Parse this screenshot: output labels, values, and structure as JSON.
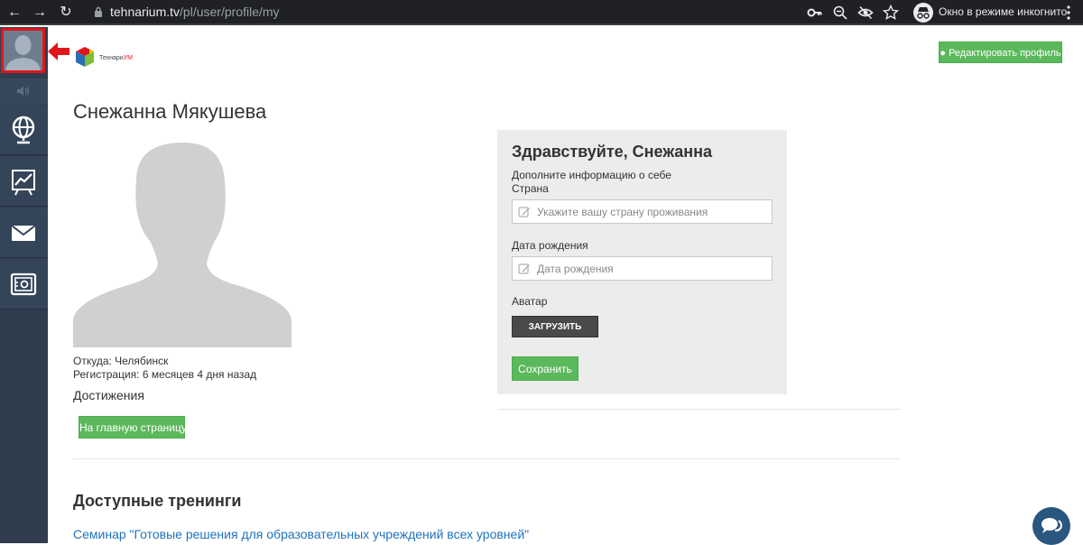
{
  "browser": {
    "back_icon": "arrow-left",
    "forward_icon": "arrow-right",
    "reload_icon": "reload",
    "url_host": "tehnarium.tv",
    "url_path": "/pl/user/profile/my",
    "incognito_label": "Окно в режиме инкогнито"
  },
  "sidebar": {
    "items": [
      {
        "icon": "user-icon"
      },
      {
        "icon": "speaker-icon"
      },
      {
        "icon": "globe-icon"
      },
      {
        "icon": "chart-icon"
      },
      {
        "icon": "mail-icon"
      },
      {
        "icon": "safe-icon"
      }
    ]
  },
  "logo": {
    "text_main": "Технари",
    "text_accent": "УМ"
  },
  "header": {
    "edit_profile_label": "Редактировать профиль"
  },
  "profile": {
    "name": "Снежанна Мякушева",
    "location": "Откуда: Челябинск",
    "registration": "Регистрация: 6 месяцев 4 дня назад",
    "achievements_label": "Достижения",
    "home_button": "На главную страницу"
  },
  "panel": {
    "greeting": "Здравствуйте, Снежанна",
    "subtitle": "Дополните информацию о себе",
    "country_label": "Страна",
    "country_placeholder": "Укажите вашу страну проживания",
    "birthdate_label": "Дата рождения",
    "birthdate_placeholder": "Дата рождения",
    "avatar_label": "Аватар",
    "upload_button": "ЗАГРУЗИТЬ",
    "save_button": "Сохранить"
  },
  "trainings": {
    "title": "Доступные тренинги",
    "items": [
      {
        "label": "Семинар \"Готовые решения для образовательных учреждений всех уровней\""
      }
    ]
  },
  "colors": {
    "sidebar_bg": "#2f3d4f",
    "accent_green": "#5cb85c",
    "highlight_red": "#e0161b",
    "link_blue": "#1e73be"
  }
}
